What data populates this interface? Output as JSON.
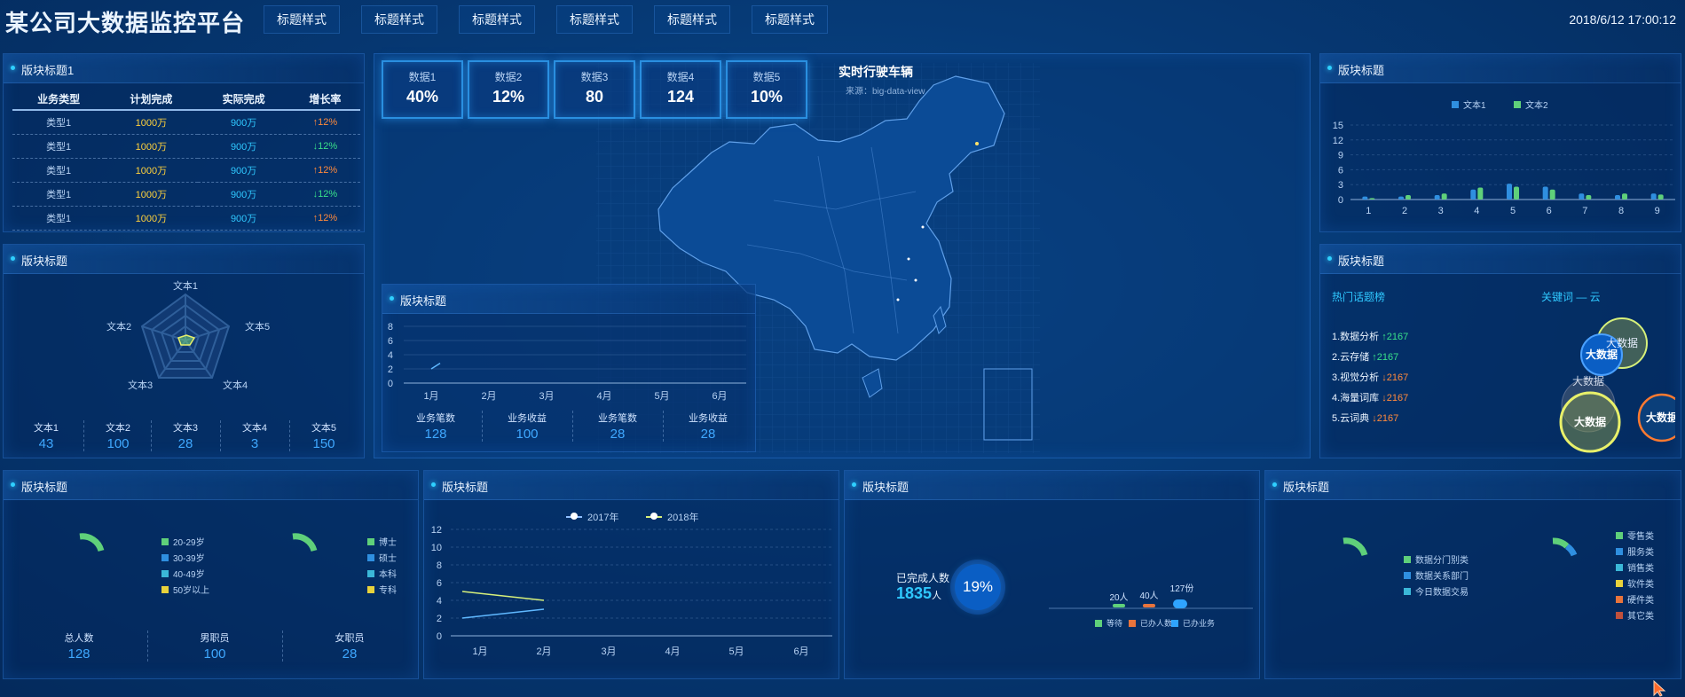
{
  "header": {
    "title": "某公司大数据监控平台",
    "tabs": [
      "标题样式",
      "标题样式",
      "标题样式",
      "标题样式",
      "标题样式",
      "标题样式"
    ],
    "datetime": "2018/6/12 17:00:12"
  },
  "business_panel": {
    "title": "版块标题1",
    "columns": [
      "业务类型",
      "计划完成",
      "实际完成",
      "增长率"
    ],
    "rows": [
      {
        "type": "类型1",
        "plan": "1000万",
        "actual": "900万",
        "rate": "↑12%",
        "dir": "up"
      },
      {
        "type": "类型1",
        "plan": "1000万",
        "actual": "900万",
        "rate": "↓12%",
        "dir": "down"
      },
      {
        "type": "类型1",
        "plan": "1000万",
        "actual": "900万",
        "rate": "↑12%",
        "dir": "up"
      },
      {
        "type": "类型1",
        "plan": "1000万",
        "actual": "900万",
        "rate": "↓12%",
        "dir": "down"
      },
      {
        "type": "类型1",
        "plan": "1000万",
        "actual": "900万",
        "rate": "↑12%",
        "dir": "up"
      }
    ]
  },
  "radar_panel": {
    "title": "版块标题",
    "axes": [
      "文本1",
      "文本5",
      "文本4",
      "文本3",
      "文本2"
    ],
    "stats": [
      {
        "label": "文本1",
        "value": "43"
      },
      {
        "label": "文本2",
        "value": "100"
      },
      {
        "label": "文本3",
        "value": "28"
      },
      {
        "label": "文本4",
        "value": "3"
      },
      {
        "label": "文本5",
        "value": "150"
      }
    ]
  },
  "kpis": [
    {
      "label": "数据1",
      "value": "40%"
    },
    {
      "label": "数据2",
      "value": "12%"
    },
    {
      "label": "数据3",
      "value": "80"
    },
    {
      "label": "数据4",
      "value": "124"
    },
    {
      "label": "数据5",
      "value": "10%"
    }
  ],
  "map": {
    "title": "实时行驶车辆",
    "source": "来源：big-data-view"
  },
  "mini_line_panel": {
    "title": "版块标题",
    "yticks": [
      "8",
      "6",
      "4",
      "2",
      "0"
    ],
    "xticks": [
      "1月",
      "2月",
      "3月",
      "4月",
      "5月",
      "6月"
    ],
    "stats": [
      {
        "label": "业务笔数",
        "value": "128"
      },
      {
        "label": "业务收益",
        "value": "100"
      },
      {
        "label": "业务笔数",
        "value": "28"
      },
      {
        "label": "业务收益",
        "value": "28"
      }
    ]
  },
  "bar_panel": {
    "title": "版块标题",
    "legend": [
      "文本1",
      "文本2"
    ]
  },
  "hot_panel": {
    "title": "版块标题",
    "left_heading": "热门话题榜",
    "right_heading": "关键词 — 云",
    "items": [
      {
        "name": "1.数据分析",
        "delta": "↑2167",
        "dir": "up"
      },
      {
        "name": "2.云存储",
        "delta": "↑2167",
        "dir": "up"
      },
      {
        "name": "3.视觉分析",
        "delta": "↓2167",
        "dir": "down"
      },
      {
        "name": "4.海量词库",
        "delta": "↓2167",
        "dir": "down"
      },
      {
        "name": "5.云词典",
        "delta": "↓2167",
        "dir": "down"
      }
    ],
    "bubbles": [
      "大数据",
      "大数据",
      "大数据",
      "大数据",
      "大数据"
    ]
  },
  "age_panel": {
    "title": "版块标题",
    "age_legend": [
      "20-29岁",
      "30-39岁",
      "40-49岁",
      "50岁以上"
    ],
    "edu_legend": [
      "博士",
      "硕士",
      "本科",
      "专科"
    ],
    "stats": [
      {
        "label": "总人数",
        "value": "128"
      },
      {
        "label": "男职员",
        "value": "100"
      },
      {
        "label": "女职员",
        "value": "28"
      }
    ]
  },
  "line_panel": {
    "title": "版块标题",
    "legend": [
      "2017年",
      "2018年"
    ],
    "yticks": [
      "12",
      "10",
      "8",
      "6",
      "4",
      "2",
      "0"
    ],
    "xticks": [
      "1月",
      "2月",
      "3月",
      "4月",
      "5月",
      "6月"
    ]
  },
  "progress_panel": {
    "title": "版块标题",
    "done_label": "已完成人数",
    "done_value": "1835",
    "done_unit": "人",
    "percent": "19%",
    "bar_labels": [
      "20人",
      "40人",
      "127份"
    ],
    "legend": [
      "等待",
      "已办人数",
      "已办业务"
    ]
  },
  "dept_panel": {
    "title": "版块标题",
    "left_legend": [
      "数据分门别类",
      "数据关系部门",
      "今日数据交易"
    ],
    "right_legend": [
      "零售类",
      "服务类",
      "销售类",
      "软件类",
      "硬件类",
      "其它类"
    ]
  },
  "chart_data": [
    {
      "type": "bar",
      "categories": [
        "1",
        "2",
        "3",
        "4",
        "5",
        "6",
        "7",
        "8",
        "9"
      ],
      "series": [
        {
          "name": "文本1",
          "values": [
            0.6,
            0.6,
            0.9,
            2.0,
            3.2,
            2.6,
            1.2,
            0.9,
            1.2
          ]
        },
        {
          "name": "文本2",
          "values": [
            0.3,
            0.9,
            1.2,
            2.4,
            2.6,
            2.0,
            0.9,
            1.2,
            1.0
          ]
        }
      ],
      "yticks": [
        "15",
        "12",
        "9",
        "6",
        "3",
        "0"
      ],
      "ylim": [
        0,
        15
      ]
    },
    {
      "type": "line",
      "x": [
        "1月",
        "2月",
        "3月",
        "4月",
        "5月",
        "6月"
      ],
      "series": [
        {
          "name": "2017年",
          "values": [
            5,
            4,
            null,
            null,
            null,
            null
          ]
        },
        {
          "name": "2018年",
          "values": [
            2,
            3,
            null,
            null,
            null,
            null
          ]
        }
      ],
      "ylim": [
        0,
        12
      ]
    },
    {
      "type": "line",
      "x": [
        "1月",
        "2月",
        "3月",
        "4月",
        "5月",
        "6月"
      ],
      "series": [
        {
          "values": [
            2,
            2.8,
            null,
            null,
            null,
            null
          ]
        }
      ],
      "ylim": [
        0,
        8
      ]
    }
  ],
  "colors": {
    "accent": "#2fc8ff",
    "series1": "#2f8fe0",
    "series2": "#5fd07a",
    "up": "#ff8a3c",
    "down": "#39e08a"
  }
}
